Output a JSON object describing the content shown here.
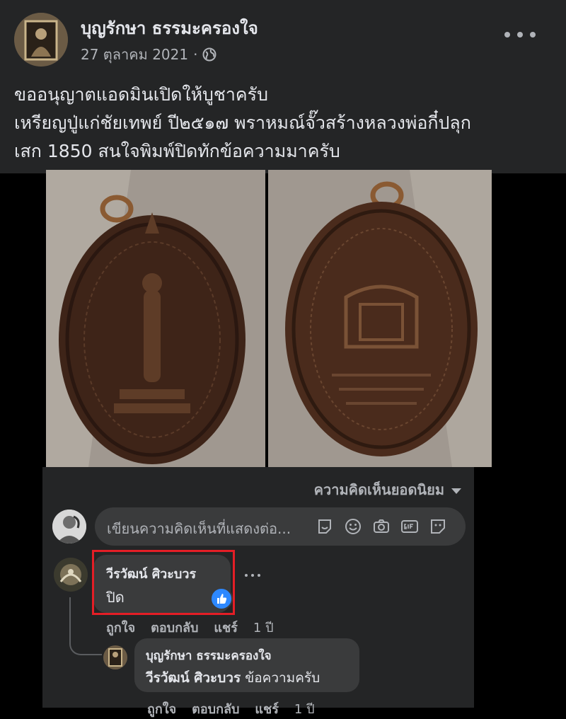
{
  "post": {
    "author": "บุญรักษา ธรรมะครองใจ",
    "date": "27 ตุลาคม 2021",
    "dot": "·",
    "audience_icon": "globe-icon",
    "lines": [
      "ขออนุญาตแอดมินเปิดให้บูชาครับ",
      "เหรียญปู่แก่ชัยเทพย์ ปี๒๕๑๗ พราหมณ์จั๊วสร้างหลวงพ่อกี๋ปลุก",
      "เสก 1850 สนใจพิมพ์ปิดทักข้อความมาครับ"
    ]
  },
  "comments_section": {
    "sort_label": "ความคิดเห็นยอดนิยม",
    "composer_placeholder": "เขียนความคิดเห็นที่แสดงต่อ...",
    "composer_icons": [
      "sticker-icon",
      "emoji-icon",
      "camera-icon",
      "gif-icon",
      "avatar-sticker-icon"
    ],
    "comments": [
      {
        "author": "วีรวัฒน์ ศิวะบวร",
        "text": "ปิด",
        "reaction": "like",
        "actions": [
          "ถูกใจ",
          "ตอบกลับ",
          "แชร์"
        ],
        "time": "1 ปี",
        "reply": {
          "author": "บุญรักษา ธรรมะครองใจ",
          "mention": "วีรวัฒน์ ศิวะบวร",
          "text": "ข้อความครับ",
          "actions": [
            "ถูกใจ",
            "ตอบกลับ",
            "แชร์"
          ],
          "time": "1 ปี"
        }
      }
    ]
  }
}
